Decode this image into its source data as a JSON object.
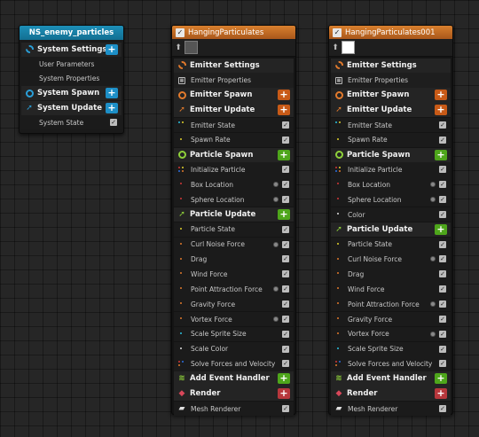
{
  "system_node": {
    "title": "NS_enemy_particles",
    "rows": [
      {
        "label": "System Settings",
        "kind": "section",
        "icon": "settings-gear-icon",
        "color": "#2a9fd8",
        "plus": "blue"
      },
      {
        "label": "User Parameters",
        "kind": "sub"
      },
      {
        "label": "System Properties",
        "kind": "sub"
      },
      {
        "label": "System Spawn",
        "kind": "section",
        "icon": "spawn-ring-icon",
        "color": "#2a9fd8",
        "plus": "blue"
      },
      {
        "label": "System Update",
        "kind": "section",
        "icon": "update-arrow-icon",
        "color": "#2a9fd8",
        "plus": "blue"
      },
      {
        "label": "System State",
        "kind": "sub",
        "check": true
      }
    ]
  },
  "emitters": [
    {
      "title": "HangingParticulates",
      "rows": [
        {
          "label": "Emitter Settings",
          "kind": "section",
          "icon": "settings-gear-icon",
          "color": "#e27a2c"
        },
        {
          "label": "Emitter Properties",
          "kind": "plain",
          "icon": "cpu-icon"
        },
        {
          "label": "Emitter Spawn",
          "kind": "section",
          "icon": "spawn-ring-icon",
          "color": "#e27a2c",
          "plus": "orange"
        },
        {
          "label": "Emitter Update",
          "kind": "section",
          "icon": "update-arrow-icon",
          "color": "#e27a2c",
          "plus": "orange"
        },
        {
          "label": "Emitter State",
          "kind": "sub",
          "dots": [
            "#2cc2e0",
            "#e2d12c"
          ],
          "check": true
        },
        {
          "label": "Spawn Rate",
          "kind": "sub",
          "dots": [
            "#e2d12c"
          ],
          "check": true
        },
        {
          "label": "Particle Spawn",
          "kind": "section",
          "icon": "spawn-ring-icon",
          "color": "#8fd13a",
          "plus": "green"
        },
        {
          "label": "Initialize Particle",
          "kind": "sub",
          "dots": [
            "#d23838",
            "#e2d12c",
            "#2c6fe2",
            "#e27a2c"
          ],
          "check": true
        },
        {
          "label": "Box Location",
          "kind": "sub",
          "dots": [
            "#d23838"
          ],
          "check": true,
          "lock": true
        },
        {
          "label": "Sphere Location",
          "kind": "sub",
          "dots": [
            "#d23838"
          ],
          "check": true,
          "lock": true
        },
        {
          "label": "Particle Update",
          "kind": "section",
          "icon": "update-arrow-icon",
          "color": "#8fd13a",
          "plus": "green"
        },
        {
          "label": "Particle State",
          "kind": "sub",
          "dots": [
            "#e2d12c"
          ],
          "check": true
        },
        {
          "label": "Curl Noise Force",
          "kind": "sub",
          "dots": [
            "#e27a2c"
          ],
          "check": true,
          "lock": true
        },
        {
          "label": "Drag",
          "kind": "sub",
          "dots": [
            "#e27a2c"
          ],
          "check": true
        },
        {
          "label": "Wind Force",
          "kind": "sub",
          "dots": [
            "#e27a2c"
          ],
          "check": true
        },
        {
          "label": "Point Attraction Force",
          "kind": "sub",
          "dots": [
            "#e27a2c"
          ],
          "check": true,
          "lock": true
        },
        {
          "label": "Gravity Force",
          "kind": "sub",
          "dots": [
            "#e27a2c"
          ],
          "check": true
        },
        {
          "label": "Vortex Force",
          "kind": "sub",
          "dots": [
            "#e27a2c"
          ],
          "check": true,
          "lock": true
        },
        {
          "label": "Scale Sprite Size",
          "kind": "sub",
          "dots": [
            "#2cc2e0"
          ],
          "check": true
        },
        {
          "label": "Scale Color",
          "kind": "sub",
          "dots": [
            "#e0e0e0"
          ],
          "check": true
        },
        {
          "label": "Solve Forces and Velocity",
          "kind": "sub",
          "dots": [
            "#d23838",
            "#2c6fe2",
            "#e27a2c"
          ],
          "check": true
        },
        {
          "label": "Add Event Handler",
          "kind": "section",
          "icon": "event-handler-icon",
          "color": "#8fd13a",
          "plus": "green"
        },
        {
          "label": "Render",
          "kind": "section",
          "icon": "render-icon",
          "color": "#d8475a",
          "plus": "red"
        },
        {
          "label": "Mesh Renderer",
          "kind": "sub",
          "icon": "mesh-icon",
          "check": true
        }
      ]
    },
    {
      "title": "HangingParticulates001",
      "rows": [
        {
          "label": "Emitter Settings",
          "kind": "section",
          "icon": "settings-gear-icon",
          "color": "#e27a2c"
        },
        {
          "label": "Emitter Properties",
          "kind": "plain",
          "icon": "cpu-icon"
        },
        {
          "label": "Emitter Spawn",
          "kind": "section",
          "icon": "spawn-ring-icon",
          "color": "#e27a2c",
          "plus": "orange"
        },
        {
          "label": "Emitter Update",
          "kind": "section",
          "icon": "update-arrow-icon",
          "color": "#e27a2c",
          "plus": "orange"
        },
        {
          "label": "Emitter State",
          "kind": "sub",
          "dots": [
            "#2cc2e0",
            "#e2d12c"
          ],
          "check": true
        },
        {
          "label": "Spawn Rate",
          "kind": "sub",
          "dots": [
            "#e2d12c"
          ],
          "check": true
        },
        {
          "label": "Particle Spawn",
          "kind": "section",
          "icon": "spawn-ring-icon",
          "color": "#8fd13a",
          "plus": "green"
        },
        {
          "label": "Initialize Particle",
          "kind": "sub",
          "dots": [
            "#d23838",
            "#e2d12c",
            "#2c6fe2",
            "#e27a2c"
          ],
          "check": true
        },
        {
          "label": "Box Location",
          "kind": "sub",
          "dots": [
            "#d23838"
          ],
          "check": true,
          "lock": true
        },
        {
          "label": "Sphere Location",
          "kind": "sub",
          "dots": [
            "#d23838"
          ],
          "check": true,
          "lock": true
        },
        {
          "label": "Color",
          "kind": "sub",
          "dots": [
            "#e0e0e0"
          ],
          "check": true
        },
        {
          "label": "Particle Update",
          "kind": "section",
          "icon": "update-arrow-icon",
          "color": "#8fd13a",
          "plus": "green"
        },
        {
          "label": "Particle State",
          "kind": "sub",
          "dots": [
            "#e2d12c"
          ],
          "check": true
        },
        {
          "label": "Curl Noise Force",
          "kind": "sub",
          "dots": [
            "#e27a2c"
          ],
          "check": true,
          "lock": true
        },
        {
          "label": "Drag",
          "kind": "sub",
          "dots": [
            "#e27a2c"
          ],
          "check": true
        },
        {
          "label": "Wind Force",
          "kind": "sub",
          "dots": [
            "#e27a2c"
          ],
          "check": true
        },
        {
          "label": "Point Attraction Force",
          "kind": "sub",
          "dots": [
            "#e27a2c"
          ],
          "check": true,
          "lock": true
        },
        {
          "label": "Gravity Force",
          "kind": "sub",
          "dots": [
            "#e27a2c"
          ],
          "check": true
        },
        {
          "label": "Vortex Force",
          "kind": "sub",
          "dots": [
            "#e27a2c"
          ],
          "check": true,
          "lock": true
        },
        {
          "label": "Scale Sprite Size",
          "kind": "sub",
          "dots": [
            "#2cc2e0"
          ],
          "check": true
        },
        {
          "label": "Solve Forces and Velocity",
          "kind": "sub",
          "dots": [
            "#d23838",
            "#2c6fe2",
            "#e27a2c"
          ],
          "check": true
        },
        {
          "label": "Add Event Handler",
          "kind": "section",
          "icon": "event-handler-icon",
          "color": "#8fd13a",
          "plus": "green"
        },
        {
          "label": "Render",
          "kind": "section",
          "icon": "render-icon",
          "color": "#d8475a",
          "plus": "red"
        },
        {
          "label": "Mesh Renderer",
          "kind": "sub",
          "icon": "mesh-icon",
          "check": true
        }
      ]
    }
  ]
}
